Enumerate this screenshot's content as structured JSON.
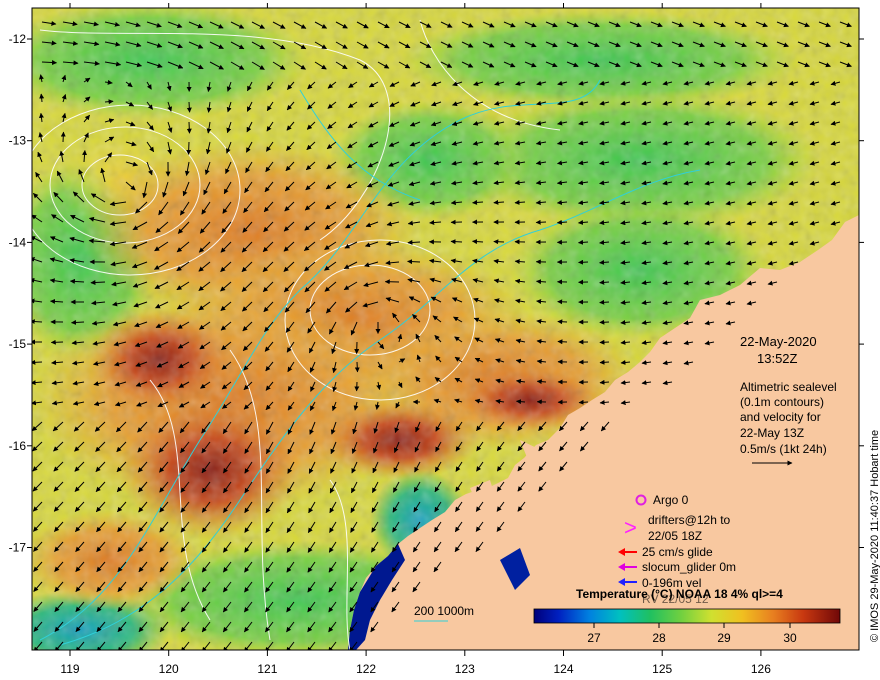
{
  "map": {
    "lon_ticks": [
      "119",
      "120",
      "121",
      "122",
      "123",
      "124",
      "125",
      "126"
    ],
    "lat_ticks": [
      "-12",
      "-13",
      "-14",
      "-15",
      "-16",
      "-17"
    ]
  },
  "info": {
    "date": "22-May-2020",
    "time": "13:52Z",
    "desc_lines": [
      "Altimetric sealevel",
      "(0.1m contours)",
      "and velocity for",
      "22-May 13Z",
      "0.5m/s (1kt 24h)"
    ]
  },
  "legend": {
    "argo": "Argo 0",
    "drifters_line1": "drifters@12h to",
    "drifters_line2": "22/05 18Z",
    "glide": "25 cm/s glide",
    "slocum": "slocum_glider 0m",
    "vel": "0-196m vel",
    "obscured": "RV 22/05 12"
  },
  "scale": {
    "text": "200  1000m"
  },
  "colorbar": {
    "title": "Temperature (°C) NOAA 18 4% ql>=4",
    "ticks": [
      "27",
      "28",
      "29",
      "30"
    ]
  },
  "sidebar": {
    "credit": "© IMOS 29-May-2020 11:40:37 Hobart time"
  },
  "colors": {
    "land": "#f8c8a0",
    "contour": "#ffffff",
    "bathymetry": "#30d0d8",
    "argo": "#e020e0",
    "drifter": "#ff20ff",
    "glide_arrow": "#ff0000",
    "slocum_arrow": "#e000e0",
    "vel_arrow": "#2020ff"
  }
}
